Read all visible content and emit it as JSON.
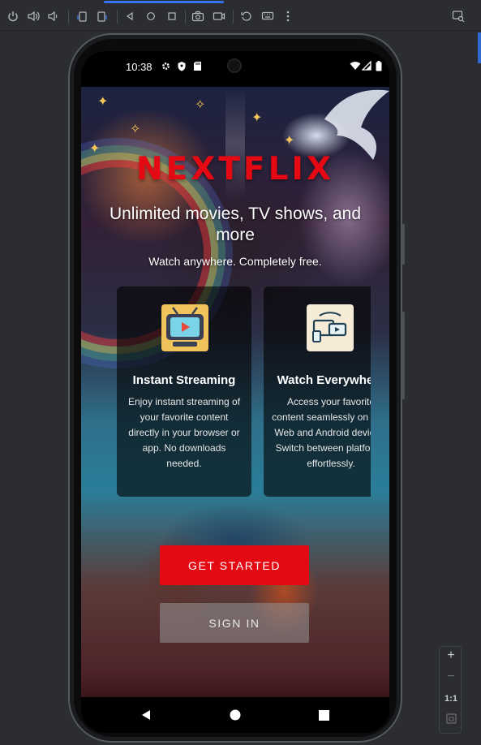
{
  "emulator": {
    "toolbar": {
      "icons": [
        "power-icon",
        "volume-up-icon",
        "volume-down-icon",
        "rotate-left-icon",
        "rotate-right-icon",
        "back-icon",
        "home-icon",
        "overview-icon",
        "camera-icon",
        "screenrecord-icon",
        "restore-icon",
        "keyboard-icon",
        "more-icon",
        "device-manager-icon"
      ]
    },
    "zoom": {
      "plus": "+",
      "minus": "−",
      "ratio": "1:1"
    }
  },
  "status_bar": {
    "time": "10:38",
    "icons": [
      "gear-icon",
      "shield-icon",
      "sd-card-icon",
      "wifi-icon",
      "signal-icon",
      "battery-icon"
    ]
  },
  "app": {
    "brand": "NEXTFLIX",
    "headline": "Unlimited movies, TV shows, and more",
    "subline": "Watch anywhere. Completely free.",
    "features": [
      {
        "title": "Instant Streaming",
        "body": "Enjoy instant streaming of your favorite content directly in your browser or app. No downloads needed."
      },
      {
        "title": "Watch Everywhere",
        "body": "Access your favorite content seamlessly on both Web and Android devices. Switch between platforms effortlessly."
      }
    ],
    "primary_button": "GET STARTED",
    "secondary_button": "SIGN IN"
  },
  "colors": {
    "brand_red": "#e50914",
    "toolbar_bg": "#2b2d30",
    "accent_blue": "#3574f0"
  }
}
